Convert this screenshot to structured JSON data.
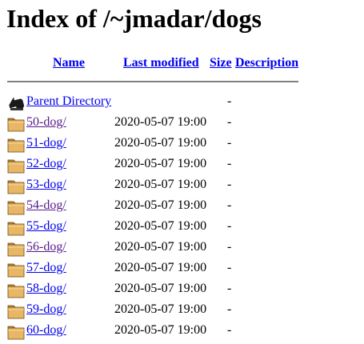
{
  "page": {
    "title": "Index of /~jmadar/dogs"
  },
  "columns": {
    "name": "Name",
    "last_modified": "Last modified",
    "size": "Size",
    "description": "Description"
  },
  "parent": {
    "icon": "back-arrow-icon",
    "label": "Parent Directory",
    "size": "-"
  },
  "rows": [
    {
      "name": "50-dog/",
      "modified": "2020-05-07 19:00",
      "size": "-",
      "visited": true
    },
    {
      "name": "51-dog/",
      "modified": "2020-05-07 19:00",
      "size": "-",
      "visited": false
    },
    {
      "name": "52-dog/",
      "modified": "2020-05-07 19:00",
      "size": "-",
      "visited": false
    },
    {
      "name": "53-dog/",
      "modified": "2020-05-07 19:00",
      "size": "-",
      "visited": false
    },
    {
      "name": "54-dog/",
      "modified": "2020-05-07 19:00",
      "size": "-",
      "visited": true
    },
    {
      "name": "55-dog/",
      "modified": "2020-05-07 19:00",
      "size": "-",
      "visited": false
    },
    {
      "name": "56-dog/",
      "modified": "2020-05-07 19:00",
      "size": "-",
      "visited": true
    },
    {
      "name": "57-dog/",
      "modified": "2020-05-07 19:00",
      "size": "-",
      "visited": false
    },
    {
      "name": "58-dog/",
      "modified": "2020-05-07 19:00",
      "size": "-",
      "visited": false
    },
    {
      "name": "59-dog/",
      "modified": "2020-05-07 19:00",
      "size": "-",
      "visited": false
    },
    {
      "name": "60-dog/",
      "modified": "2020-05-07 19:00",
      "size": "-",
      "visited": false
    }
  ],
  "colors": {
    "link": "#0000ee",
    "visited_link": "#551a8b",
    "rule": "#808080",
    "folder": "#e8b765"
  },
  "row_icon": "folder-icon"
}
